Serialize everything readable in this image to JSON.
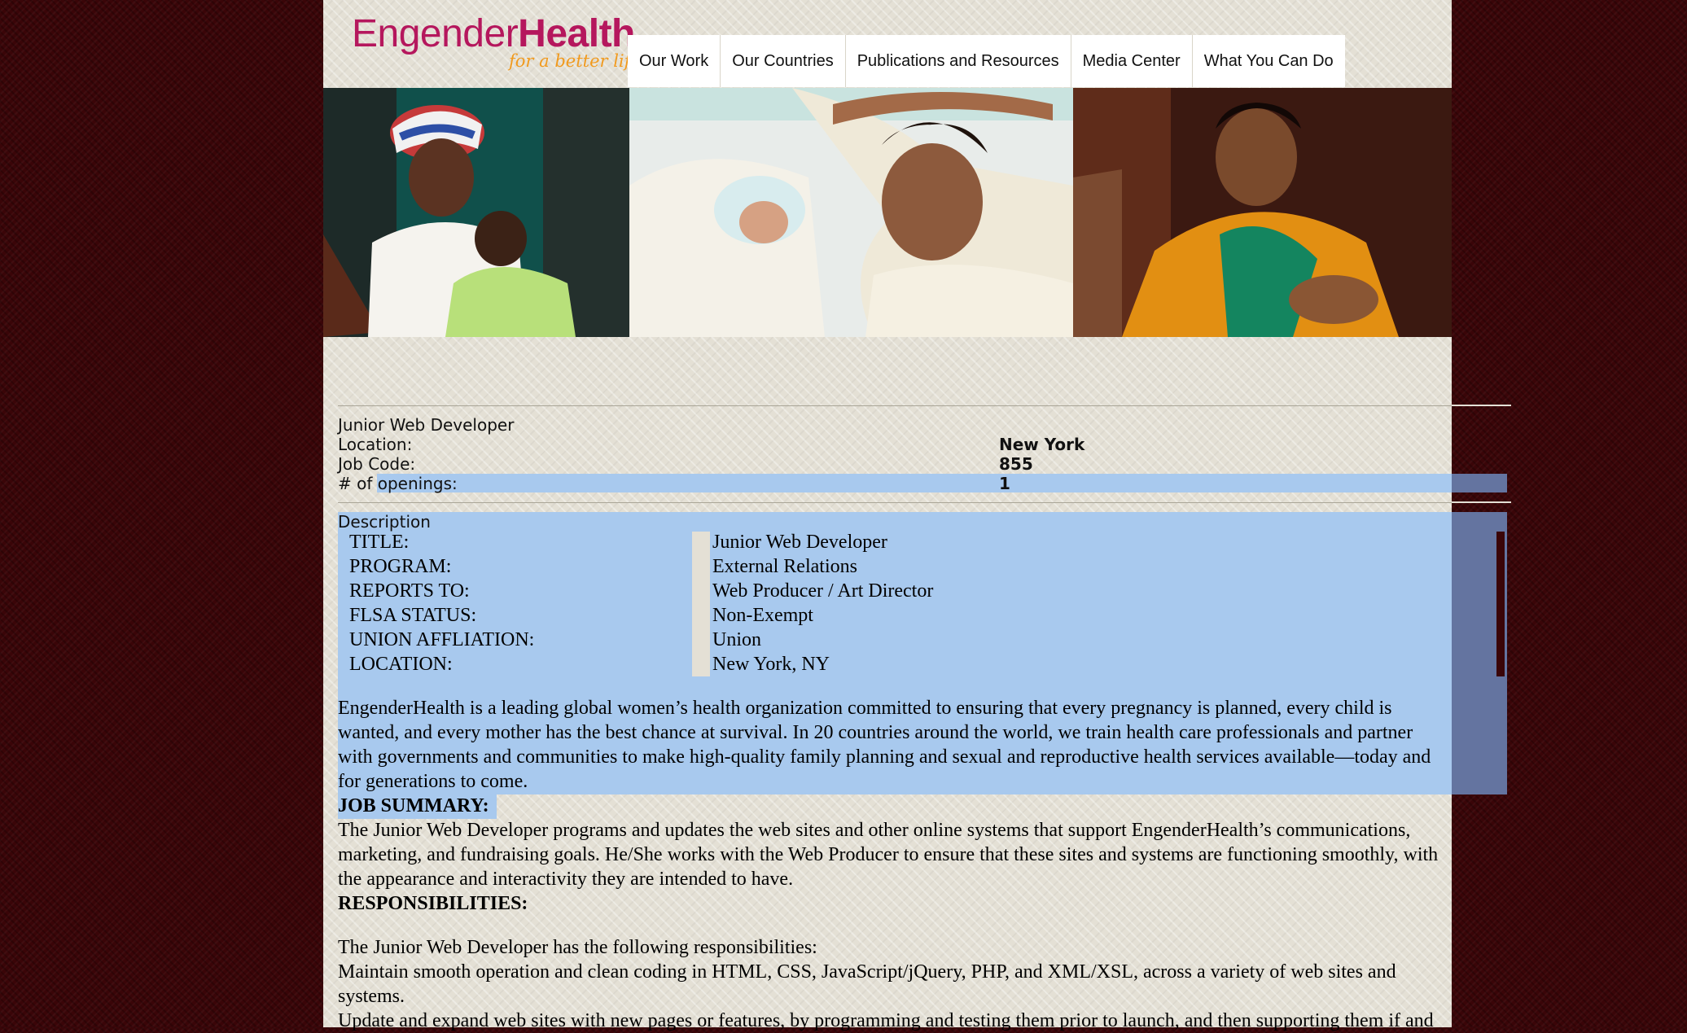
{
  "site": {
    "logo_main": "Engender",
    "logo_bold": "Health",
    "tagline": "for a better life"
  },
  "nav": {
    "items": [
      {
        "label": "Our Work"
      },
      {
        "label": "Our Countries"
      },
      {
        "label": "Publications and Resources"
      },
      {
        "label": "Media Center"
      },
      {
        "label": "What You Can Do"
      }
    ]
  },
  "job": {
    "title": "Junior Web Developer",
    "location_label": "Location:",
    "location_value": "New York",
    "code_label": "Job Code:",
    "code_value": "855",
    "openings_label": "# of openings:",
    "openings_value": "1",
    "description_label": "Description"
  },
  "details": [
    {
      "label": "TITLE:",
      "value": "Junior Web Developer"
    },
    {
      "label": "PROGRAM:",
      "value": "External Relations"
    },
    {
      "label": "REPORTS TO:",
      "value": "Web Producer / Art Director"
    },
    {
      "label": "FLSA STATUS:",
      "value": "Non-Exempt"
    },
    {
      "label": "UNION AFFLIATION:",
      "value": "Union"
    },
    {
      "label": "LOCATION:",
      "value": "New York, NY"
    }
  ],
  "body": {
    "intro_lines": [
      "EngenderHealth is a leading global women’s health organization committed to ensuring that every pregnancy is planned, every child is",
      "wanted, and every mother has the best chance at survival. In 20 countries around the world, we train health care professionals and partner",
      "with governments and communities to make high-quality family planning and sexual and reproductive health services available—today and",
      "for generations to come."
    ],
    "summary_heading": "JOB SUMMARY:",
    "summary_lines": [
      "The Junior Web Developer programs and updates the web sites and other online systems that support EngenderHealth’s communications,",
      "marketing, and fundraising goals. He/She works with the Web Producer to ensure that these sites and systems are functioning smoothly, with",
      "the appearance and interactivity they are intended to have."
    ],
    "responsibilities_heading": "RESPONSIBILITIES:",
    "responsibilities_lines": [
      "The Junior Web Developer has the following responsibilities:",
      "Maintain smooth operation and clean coding in HTML, CSS, JavaScript/jQuery, PHP, and XML/XSL, across a variety of web sites and",
      "systems.",
      "Update and expand web sites with new pages or features, by programming and testing them prior to launch, and then supporting them if and"
    ]
  },
  "colors": {
    "brand_magenta": "#b5175d",
    "brand_orange": "#f19a1e",
    "selection": "#a8c9ee",
    "outer_background": "#3a0508"
  }
}
